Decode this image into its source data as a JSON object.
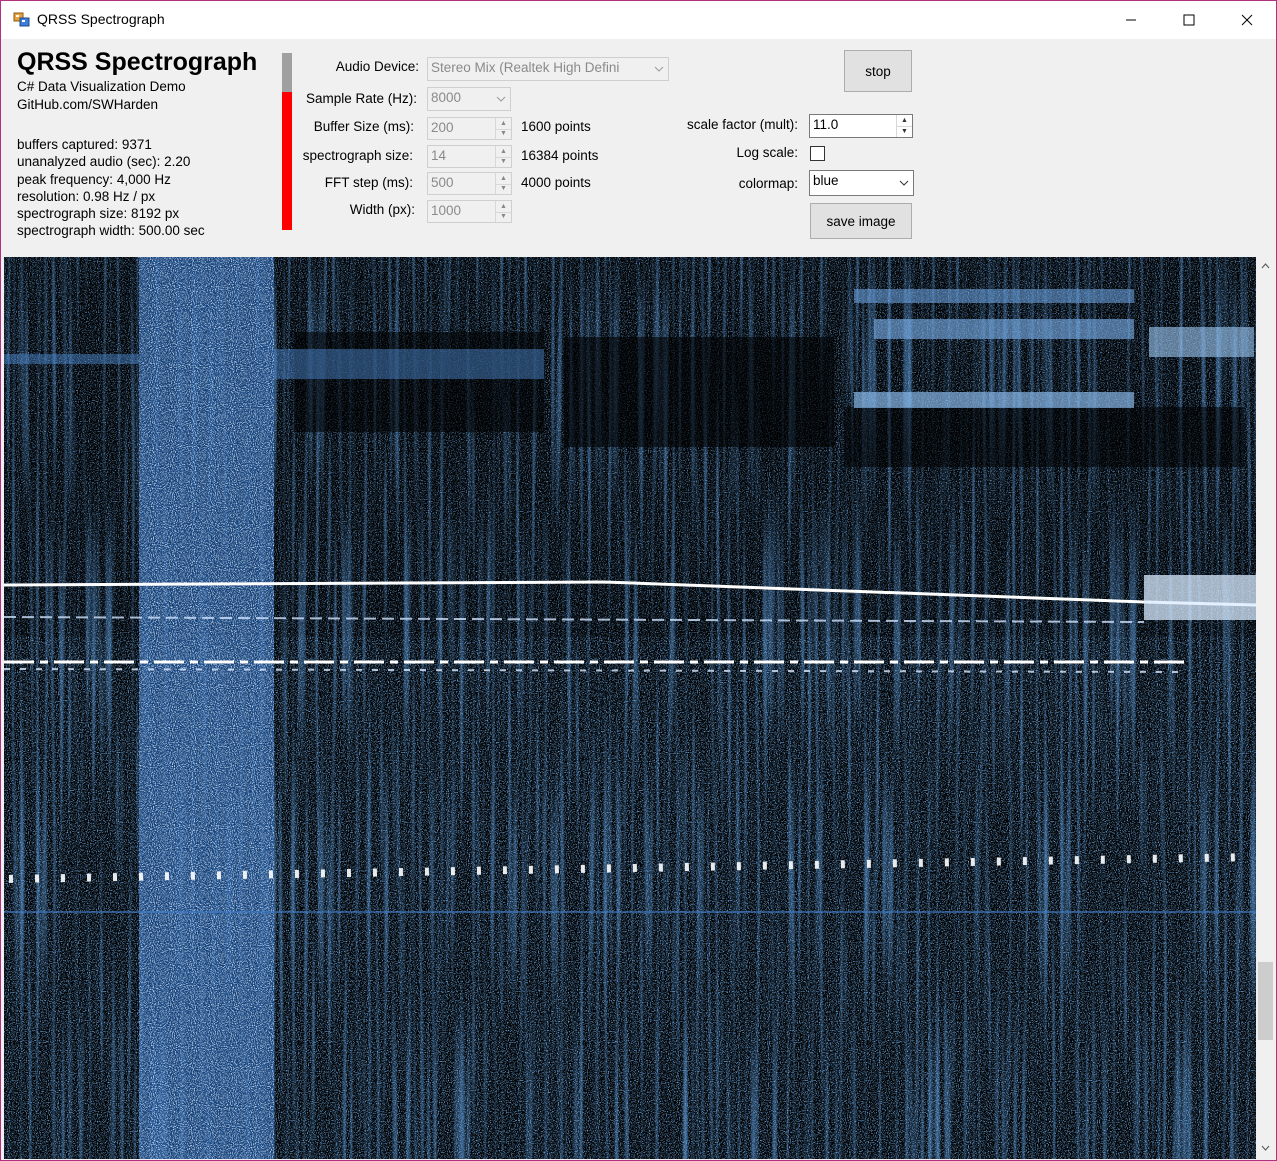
{
  "window": {
    "title": "QRSS Spectrograph"
  },
  "header": {
    "app_title": "QRSS Spectrograph",
    "subtitle": "C# Data Visualization Demo",
    "link": "GitHub.com/SWHarden"
  },
  "stats": {
    "buffers_captured": "buffers captured:  9371",
    "unanalyzed_audio": "unanalyzed audio (sec):  2.20",
    "peak_frequency": "peak frequency: 4,000 Hz",
    "resolution": "resolution:  0.98 Hz / px",
    "spectrograph_size": "spectrograph size:  8192 px",
    "spectrograph_width": "spectrograph width: 500.00 sec"
  },
  "level_meter": {
    "level": 0.78,
    "fill_color": "#ff0000",
    "track_color": "#a0a0a0"
  },
  "settings": {
    "audio_device": {
      "label": "Audio Device:",
      "value": "Stereo Mix (Realtek High Defini"
    },
    "sample_rate": {
      "label": "Sample Rate (Hz):",
      "value": "8000"
    },
    "buffer_size": {
      "label": "Buffer Size (ms):",
      "value": "200",
      "points": "1600 points"
    },
    "spectrograph_size": {
      "label": "spectrograph size:",
      "value": "14",
      "points": "16384 points"
    },
    "fft_step": {
      "label": "FFT step (ms):",
      "value": "500",
      "points": "4000 points"
    },
    "width": {
      "label": "Width (px):",
      "value": "1000"
    }
  },
  "controls": {
    "stop_label": "stop",
    "scale_factor": {
      "label": "scale factor (mult):",
      "value": "11.0"
    },
    "log_scale": {
      "label": "Log scale:",
      "checked": false
    },
    "colormap": {
      "label": "colormap:",
      "value": "blue"
    },
    "save_label": "save image"
  },
  "colors": {
    "spectrogram_background": "#000000",
    "colormap_accent": "#2f7fd6",
    "peak": "#ffffff",
    "window_border": "#b0317f"
  },
  "icons": [
    "app-icon",
    "minimize-icon",
    "maximize-icon",
    "close-icon",
    "chevron-down-icon",
    "spin-up-icon",
    "spin-down-icon"
  ]
}
